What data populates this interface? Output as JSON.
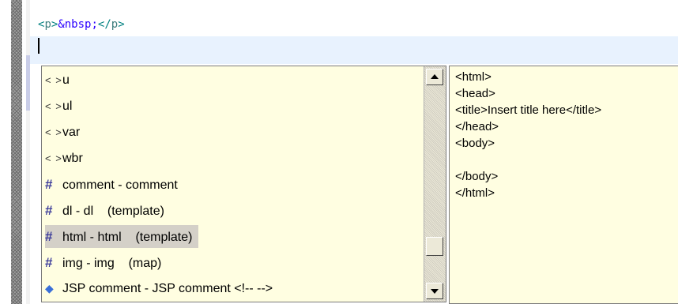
{
  "editor": {
    "code_line": {
      "open_bracket": "<",
      "open_tag": "p",
      "close_bracket": ">",
      "entity": "&nbsp;",
      "close_open_bracket": "</",
      "close_tag": "p",
      "close_close_bracket": ">"
    }
  },
  "proposals": [
    {
      "icon": "tag-icon",
      "glyph": "< >",
      "label": "u",
      "selected": false
    },
    {
      "icon": "tag-icon",
      "glyph": "< >",
      "label": "ul",
      "selected": false
    },
    {
      "icon": "tag-icon",
      "glyph": "< >",
      "label": "var",
      "selected": false
    },
    {
      "icon": "tag-icon",
      "glyph": "< >",
      "label": "wbr",
      "selected": false
    },
    {
      "icon": "template-icon",
      "glyph": "#",
      "label": "comment - comment",
      "selected": false
    },
    {
      "icon": "template-icon",
      "glyph": "#",
      "label": "dl - dl    (template)",
      "selected": false
    },
    {
      "icon": "template-icon",
      "glyph": "#",
      "label": "html - html    (template)",
      "selected": true
    },
    {
      "icon": "template-icon",
      "glyph": "#",
      "label": "img - img    (map)",
      "selected": false
    },
    {
      "icon": "jsp-comment-icon",
      "glyph": "◆",
      "label": "JSP comment - JSP comment <!-- -->",
      "selected": false
    }
  ],
  "preview": {
    "lines": [
      "<html>",
      "<head>",
      "<title>Insert title here</title>",
      "</head>",
      "<body>",
      "",
      "</body>",
      "</html>"
    ]
  }
}
